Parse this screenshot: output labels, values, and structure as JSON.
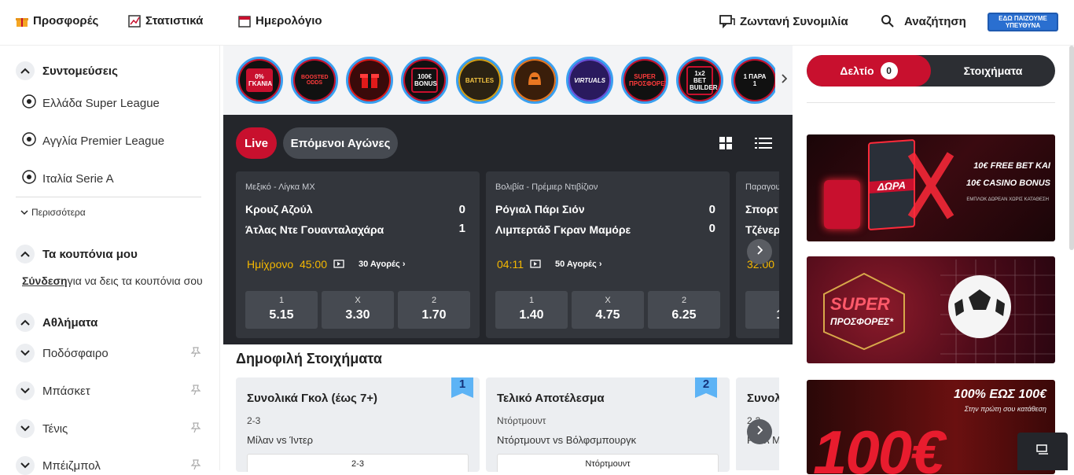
{
  "nav": {
    "offers": "Προσφορές",
    "stats": "Στατιστικά",
    "calendar": "Ημερολόγιο",
    "live_chat": "Ζωντανή Συνομιλία",
    "search": "Αναζήτηση",
    "responsible_logo": "ΕΔΩ ΠΑΙΖΟΥΜΕ ΥΠΕΥΘΥΝΑ"
  },
  "sidebar": {
    "shortcuts_title": "Συντομεύσεις",
    "shortcuts": [
      "Ελλάδα Super League",
      "Αγγλία Premier League",
      "Ιταλία Serie A"
    ],
    "more": "Περισσότερα",
    "coupons_title": "Τα κουπόνια μου",
    "login_link": "Σύνδεση",
    "login_text": "για να δεις τα κουπόνια σου",
    "sports_title": "Αθλήματα",
    "sports": [
      "Ποδόσφαιρο",
      "Μπάσκετ",
      "Τένις",
      "Μπέιζμπολ"
    ]
  },
  "promos": [
    {
      "label": "0% ΓΚΑΝΙΑ",
      "color": "#c8102e"
    },
    {
      "label": "BOOSTED ODDS",
      "color": "#c8102e"
    },
    {
      "label": "",
      "color": "#e01a1a"
    },
    {
      "label": "100€ BONUS",
      "color": "#c8102e"
    },
    {
      "label": "BATTLES",
      "color": "#d4a017"
    },
    {
      "label": "",
      "color": "#e87722"
    },
    {
      "label": "VIRTUALS",
      "color": "#6b4fd8"
    },
    {
      "label": "SUPER ΠΡΟΣΦΟΡΕΣ",
      "color": "#c8102e"
    },
    {
      "label": "1x2 BET BUILDER",
      "color": "#c8102e"
    },
    {
      "label": "1 ΠΑΡΑ 1",
      "color": "#c8102e"
    }
  ],
  "live": {
    "tab_live": "Live",
    "tab_next": "Επόμενοι Αγώνες",
    "matches": [
      {
        "league": "Μεξικό - Λίγκα MX",
        "home": "Κρουζ Αζούλ",
        "home_score": "0",
        "away": "Άτλας Ντε Γουανταλαχάρα",
        "away_score": "1",
        "time": "Ημίχρονο  45:00",
        "markets": "30 Αγορές",
        "odds": [
          {
            "l": "1",
            "v": "5.15"
          },
          {
            "l": "X",
            "v": "3.30"
          },
          {
            "l": "2",
            "v": "1.70"
          }
        ]
      },
      {
        "league": "Βολιβία - Πρέμιερ Ντιβίζιον",
        "home": "Ρόγιαλ Πάρι Σιόν",
        "home_score": "0",
        "away": "Λιμπερτάδ Γκραν Μαμόρε",
        "away_score": "0",
        "time": "04:11",
        "markets": "50 Αγορές",
        "odds": [
          {
            "l": "1",
            "v": "1.40"
          },
          {
            "l": "X",
            "v": "4.75"
          },
          {
            "l": "2",
            "v": "6.25"
          }
        ]
      },
      {
        "league": "Παραγου",
        "home": "Σπορτ",
        "away": "Τζένερ",
        "time": "32:00",
        "odds": [
          {
            "l": "1",
            "v": "1."
          }
        ]
      }
    ]
  },
  "popular": {
    "title": "Δημοφιλή Στοιχήματα",
    "cards": [
      {
        "rank": "1",
        "title": "Συνολικά Γκολ (έως 7+)",
        "sel": "2-3",
        "match": "Μίλαν vs Ίντερ",
        "btn": "2-3"
      },
      {
        "rank": "2",
        "title": "Τελικό Αποτέλεσμα",
        "sel": "Ντόρτμουντ",
        "match": "Ντόρτμουντ vs Βόλφσμπουργκ",
        "btn": "Ντόρτμουντ"
      },
      {
        "title": "Συνολ",
        "sel": "2-3",
        "match": "Ρεάλ Μ"
      }
    ]
  },
  "betslip": {
    "tab1": "Δελτίο",
    "count": "0",
    "tab2": "Στοιχήματα"
  },
  "banners": {
    "b1_line1": "10€ FREE BET ΚΑΙ",
    "b1_line2": "10€ CASINO BONUS",
    "b1_small": "ΕΜΠΛΟΚ ΔΩΡΕΑΝ ΧΩΡΙΣ ΚΑΤΑΘΕΣΗ",
    "b1_box": "ΔΩΡΑ",
    "b2_line1": "SUPER",
    "b2_line2": "ΠΡΟΣΦΟΡΕΣ*",
    "b3_line1": "100% ΕΩΣ 100€",
    "b3_line2": "Στην πρώτη σου κατάθεση",
    "b3_big": "100€"
  }
}
